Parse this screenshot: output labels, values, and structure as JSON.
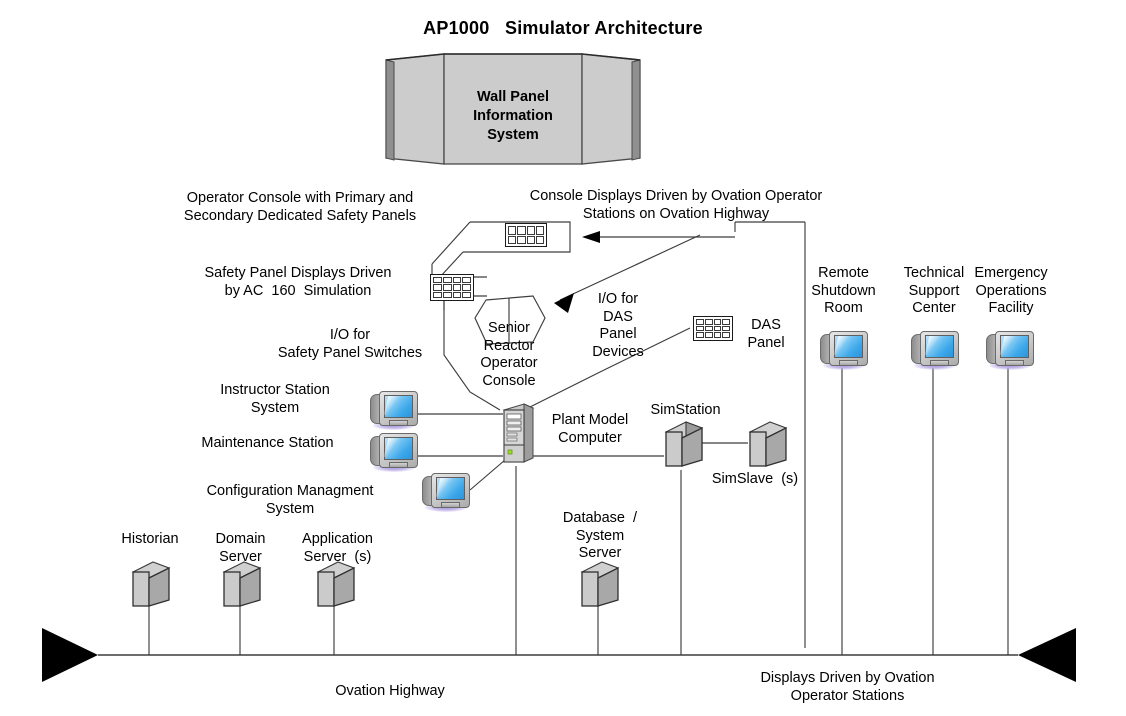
{
  "diagram": {
    "title": "AP1000   Simulator Architecture",
    "type": "system-architecture-block-diagram"
  },
  "wall_panel": {
    "lines": [
      "Wall Panel",
      "Information",
      "System"
    ],
    "fill_color": "#cccccc",
    "edge_color": "#808080"
  },
  "labels": {
    "operator_console": "Operator Console with Primary and\nSecondary Dedicated Safety Panels",
    "console_displays": "Console Displays Driven by Ovation Operator\nStations on Ovation Highway",
    "safety_panel_displays": "Safety Panel Displays Driven\nby AC  160  Simulation",
    "io_safety_panel": "I/O for\nSafety Panel Switches",
    "io_das": "I/O for\nDAS\nPanel\nDevices",
    "sro_console": "Senior\nReactor\nOperator\nConsole",
    "das_panel": "DAS\nPanel",
    "instructor_station": "Instructor Station\nSystem",
    "maintenance_station": "Maintenance Station",
    "config_management": "Configuration Managment\nSystem",
    "plant_model_computer": "Plant Model\nComputer",
    "simstation": "SimStation",
    "simslave": "SimSlave  (s)",
    "remote_shutdown": "Remote\nShutdown\nRoom",
    "technical_support": "Technical\nSupport\nCenter",
    "emergency_operations": "Emergency\nOperations\nFacility",
    "historian": "Historian",
    "domain_server": "Domain\nServer",
    "application_server": "Application\nServer  (s)",
    "database_system_server": "Database  /\nSystem\nServer",
    "ovation_highway": "Ovation Highway",
    "displays_driven": "Displays Driven by Ovation\nOperator Stations"
  },
  "nodes": [
    {
      "id": "wall-panel-information-system",
      "label": "Wall Panel Information System",
      "icon": "wall-panel"
    },
    {
      "id": "primary-safety-panel",
      "label": "Primary Dedicated Safety Panel",
      "icon": "grid-panel"
    },
    {
      "id": "secondary-safety-panel",
      "label": "Secondary Dedicated Safety Panel",
      "icon": "grid-panel"
    },
    {
      "id": "senior-reactor-operator-console",
      "label": "Senior Reactor Operator Console",
      "icon": "console-desk"
    },
    {
      "id": "das-panel",
      "label": "DAS Panel",
      "icon": "grid-panel"
    },
    {
      "id": "instructor-station",
      "label": "Instructor Station System",
      "icon": "crt-monitor"
    },
    {
      "id": "maintenance-station",
      "label": "Maintenance Station",
      "icon": "crt-monitor"
    },
    {
      "id": "configuration-management-system",
      "label": "Configuration Managment System",
      "icon": "crt-monitor"
    },
    {
      "id": "plant-model-computer",
      "label": "Plant Model Computer",
      "icon": "tower-computer"
    },
    {
      "id": "simstation",
      "label": "SimStation",
      "icon": "server-cube"
    },
    {
      "id": "simslave",
      "label": "SimSlave (s)",
      "icon": "server-cube"
    },
    {
      "id": "historian",
      "label": "Historian",
      "icon": "server-cube"
    },
    {
      "id": "domain-server",
      "label": "Domain Server",
      "icon": "server-cube"
    },
    {
      "id": "application-server",
      "label": "Application Server (s)",
      "icon": "server-cube"
    },
    {
      "id": "database-system-server",
      "label": "Database / System Server",
      "icon": "server-cube"
    },
    {
      "id": "remote-shutdown-room",
      "label": "Remote Shutdown Room",
      "icon": "crt-monitor"
    },
    {
      "id": "technical-support-center",
      "label": "Technical Support Center",
      "icon": "crt-monitor"
    },
    {
      "id": "emergency-operations-facility",
      "label": "Emergency Operations Facility",
      "icon": "crt-monitor"
    }
  ],
  "bus": {
    "name": "Ovation Highway",
    "left_arrow": "left-arrowhead",
    "right_arrow": "right-arrowhead",
    "drop_connections": [
      "historian",
      "domain-server",
      "application-server",
      "plant-model-computer",
      "database-system-server",
      "simstation",
      "console-displays",
      "remote-shutdown-room",
      "technical-support-center",
      "emergency-operations-facility"
    ]
  },
  "colors": {
    "line": "#3d3d3d",
    "text": "#000000",
    "panel_fill": "#cccccc",
    "monitor_screen": "#3ba7ea",
    "monitor_shadow": "#9a86d6",
    "arrow_fill": "#000000"
  }
}
